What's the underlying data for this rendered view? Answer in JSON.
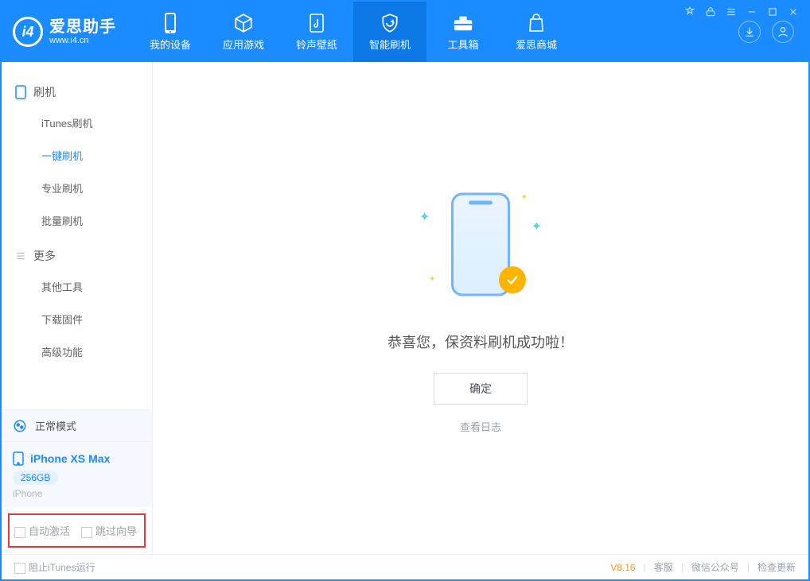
{
  "app": {
    "name": "爱思助手",
    "url": "www.i4.cn"
  },
  "nav": {
    "items": [
      {
        "label": "我的设备"
      },
      {
        "label": "应用游戏"
      },
      {
        "label": "铃声壁纸"
      },
      {
        "label": "智能刷机"
      },
      {
        "label": "工具箱"
      },
      {
        "label": "爱思商城"
      }
    ],
    "active_index": 3
  },
  "sidebar": {
    "groups": [
      {
        "title": "刷机",
        "items": [
          {
            "label": "iTunes刷机"
          },
          {
            "label": "一键刷机"
          },
          {
            "label": "专业刷机"
          },
          {
            "label": "批量刷机"
          }
        ],
        "active_index": 1
      },
      {
        "title": "更多",
        "items": [
          {
            "label": "其他工具"
          },
          {
            "label": "下载固件"
          },
          {
            "label": "高级功能"
          }
        ]
      }
    ],
    "mode": "正常模式",
    "device": {
      "name": "iPhone XS Max",
      "capacity": "256GB",
      "type": "iPhone"
    },
    "checks": {
      "auto_activate": "自动激活",
      "skip_guide": "跳过向导"
    }
  },
  "main": {
    "headline": "恭喜您，保资料刷机成功啦！",
    "ok": "确定",
    "view_log": "查看日志"
  },
  "footer": {
    "block_itunes": "阻止iTunes运行",
    "version": "V8.16",
    "links": {
      "support": "客服",
      "wechat": "微信公众号",
      "update": "检查更新"
    }
  }
}
